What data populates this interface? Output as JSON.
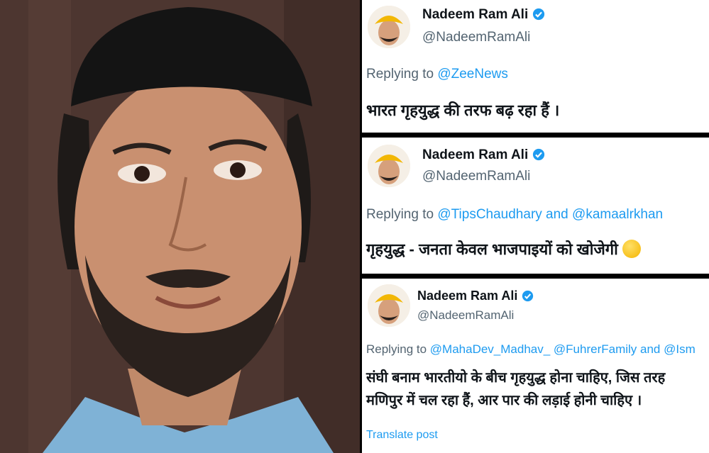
{
  "photo": {
    "alt_subject": "portrait"
  },
  "tweets": [
    {
      "name": "Nadeem Ram Ali",
      "handle": "@NadeemRamAli",
      "replying_prefix": "Replying to ",
      "mentions": "@ZeeNews",
      "body": "भारत गृहयुद्ध की तरफ बढ़ रहा हैं ।"
    },
    {
      "name": "Nadeem Ram Ali",
      "handle": "@NadeemRamAli",
      "replying_prefix": "Replying to ",
      "mentions": "@TipsChaudhary and @kamaalrkhan",
      "body": "गृहयुद्ध - जनता केवल भाजपाइयों को खोजेगी"
    },
    {
      "name": "Nadeem Ram Ali",
      "handle": "@NadeemRamAli",
      "replying_prefix": "Replying to ",
      "mentions": "@MahaDev_Madhav_ @FuhrerFamily and @Ism",
      "body_line1": "संघी बनाम भारतीयो के बीच गृहयुद्ध होना चाहिए, जिस तरह",
      "body_line2": "मणिपुर में चल रहा हैं, आर पार की लड़ाई होनी चाहिए ।",
      "translate": "Translate post"
    }
  ],
  "colors": {
    "verified": "#1d9bf0",
    "link": "#1d9bf0",
    "muted": "#536471",
    "text": "#0f1419"
  },
  "icons": {
    "verified": "verified-badge-icon",
    "emoji": "laughing-emoji-icon"
  }
}
